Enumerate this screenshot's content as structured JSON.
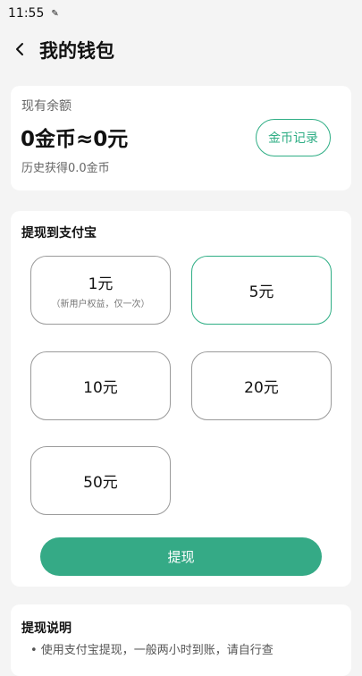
{
  "status_bar": {
    "time": "11:55",
    "notification_glyph": "✎"
  },
  "header": {
    "back_icon": "chevron-left",
    "title": "我的钱包"
  },
  "balance": {
    "label": "现有余额",
    "amount": "0金币≈0元",
    "history": "历史获得0.0金币",
    "record_button": "金币记录"
  },
  "withdraw": {
    "section_title": "提现到支付宝",
    "options": [
      {
        "value": "1元",
        "note": "（新用户权益，仅一次）",
        "selected": false
      },
      {
        "value": "5元",
        "note": "",
        "selected": true
      },
      {
        "value": "10元",
        "note": "",
        "selected": false
      },
      {
        "value": "20元",
        "note": "",
        "selected": false
      },
      {
        "value": "50元",
        "note": "",
        "selected": false
      }
    ],
    "button_label": "提现"
  },
  "description": {
    "section_title": "提现说明",
    "text_partial": "• 使用支付宝提现，一般两小时到账，请自行查"
  },
  "colors": {
    "accent": "#2fae85",
    "button": "#35aa86",
    "background": "#f4f4f4"
  }
}
